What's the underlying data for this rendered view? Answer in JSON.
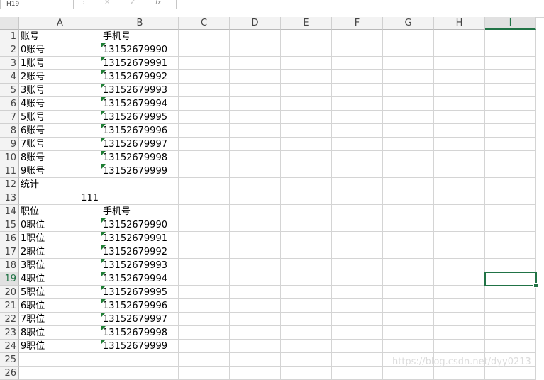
{
  "formula_bar": {
    "name_box": "H19",
    "separator": ":",
    "cancel_icon": "✕",
    "enter_icon": "✓",
    "fx_label": "fx",
    "formula_value": ""
  },
  "columns": [
    "A",
    "B",
    "C",
    "D",
    "E",
    "F",
    "G",
    "H",
    "I"
  ],
  "rows": [
    "1",
    "2",
    "3",
    "4",
    "5",
    "6",
    "7",
    "8",
    "9",
    "10",
    "11",
    "12",
    "13",
    "14",
    "15",
    "16",
    "17",
    "18",
    "19",
    "20",
    "21",
    "22",
    "23",
    "24",
    "25",
    "26"
  ],
  "cells": [
    [
      "账号",
      "手机号"
    ],
    [
      "0账号",
      "13152679990"
    ],
    [
      "1账号",
      "13152679991"
    ],
    [
      "2账号",
      "13152679992"
    ],
    [
      "3账号",
      "13152679993"
    ],
    [
      "4账号",
      "13152679994"
    ],
    [
      "5账号",
      "13152679995"
    ],
    [
      "6账号",
      "13152679996"
    ],
    [
      "7账号",
      "13152679997"
    ],
    [
      "8账号",
      "13152679998"
    ],
    [
      "9账号",
      "13152679999"
    ],
    [
      "统计",
      ""
    ],
    [
      "111",
      ""
    ],
    [
      "职位",
      "手机号"
    ],
    [
      "0职位",
      "13152679990"
    ],
    [
      "1职位",
      "13152679991"
    ],
    [
      "2职位",
      "13152679992"
    ],
    [
      "3职位",
      "13152679993"
    ],
    [
      "4职位",
      "13152679994"
    ],
    [
      "5职位",
      "13152679995"
    ],
    [
      "6职位",
      "13152679996"
    ],
    [
      "7职位",
      "13152679997"
    ],
    [
      "8职位",
      "13152679998"
    ],
    [
      "9职位",
      "13152679999"
    ],
    [
      "",
      ""
    ],
    [
      "",
      ""
    ]
  ],
  "text_number_rows": [
    1,
    2,
    3,
    4,
    5,
    6,
    7,
    8,
    9,
    10,
    14,
    15,
    16,
    17,
    18,
    19,
    20,
    21,
    22,
    23
  ],
  "numeric_right_rows": [
    12
  ],
  "selection": {
    "row": 19,
    "column": "I"
  },
  "watermark": "https://blog.csdn.net/dyy0213",
  "colors": {
    "accent": "#217346",
    "error_triangle": "#1e7e34"
  }
}
